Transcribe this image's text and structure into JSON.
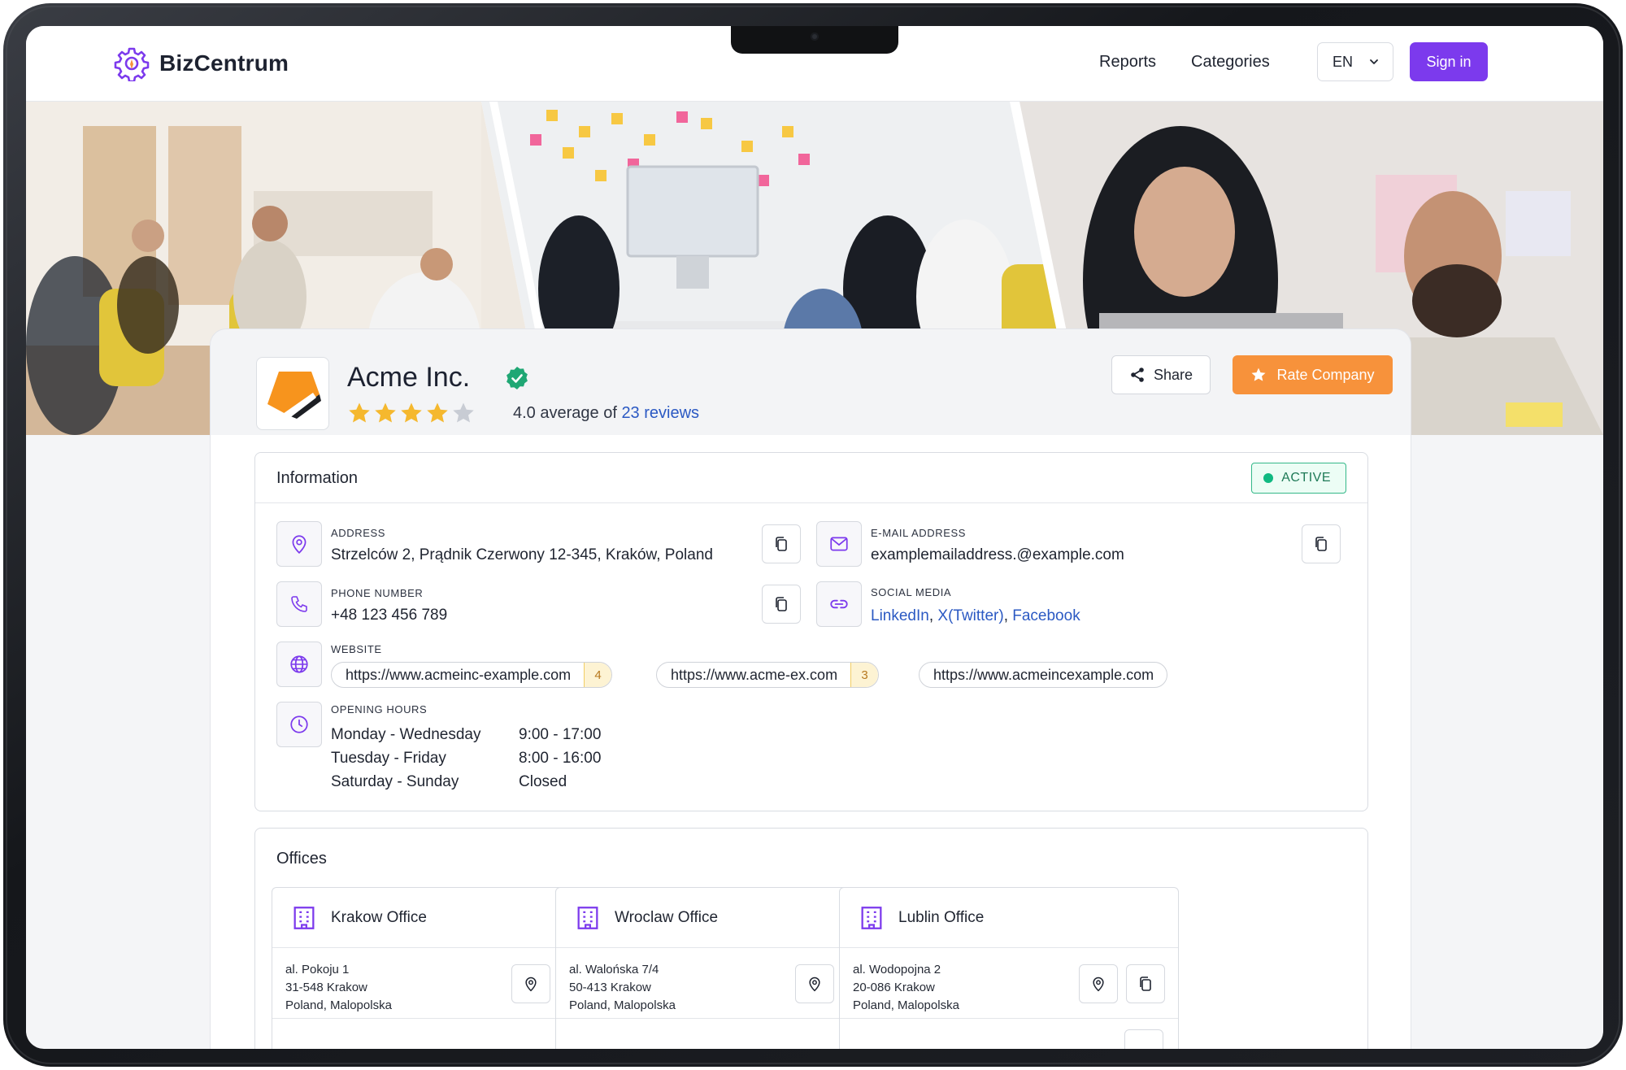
{
  "app": {
    "brand": "BizCentrum"
  },
  "nav": {
    "reports": "Reports",
    "categories": "Categories",
    "language": "EN",
    "sign_in": "Sign in"
  },
  "company": {
    "name": "Acme Inc.",
    "verified": true,
    "rating": 4.0,
    "rating_max": 5,
    "rating_prefix": "4.0 average of",
    "reviews_link": "23 reviews",
    "share_label": "Share",
    "rate_label": "Rate Company"
  },
  "information": {
    "title": "Information",
    "status": "ACTIVE",
    "address_label": "ADDRESS",
    "address": "Strzelców 2, Prądnik Czerwony 12-345, Kraków, Poland",
    "email_label": "E-MAIL ADDRESS",
    "email": "examplemailaddress.@example.com",
    "phone_label": "PHONE NUMBER",
    "phone": "+48 123 456 789",
    "social_label": "SOCIAL MEDIA",
    "social": [
      "LinkedIn",
      "X(Twitter)",
      "Facebook"
    ],
    "social_sep": ", ",
    "website_label": "WEBSITE",
    "websites": [
      {
        "url": "https://www.acmeinc-example.com",
        "count": "4"
      },
      {
        "url": "https://www.acme-ex.com",
        "count": "3"
      },
      {
        "url": "https://www.acmeincexample.com",
        "count": ""
      }
    ],
    "hours_label": "OPENING HOURS",
    "hours": [
      {
        "days": "Monday - Wednesday",
        "time": "9:00 - 17:00"
      },
      {
        "days": "Tuesday - Friday",
        "time": "8:00 - 16:00"
      },
      {
        "days": "Saturday - Sunday",
        "time": "Closed"
      }
    ]
  },
  "offices": {
    "title": "Offices",
    "items": [
      {
        "name": "Krakow Office",
        "line1": "al. Pokoju 1",
        "line2": "31-548 Krakow",
        "line3": "Poland, Malopolska"
      },
      {
        "name": "Wroclaw Office",
        "line1": "al. Walońska 7/4",
        "line2": "50-413 Krakow",
        "line3": "Poland, Malopolska"
      },
      {
        "name": "Lublin Office",
        "line1": "al. Wodopojna 2",
        "line2": "20-086 Krakow",
        "line3": "Poland, Malopolska"
      }
    ]
  },
  "colors": {
    "accent": "#7c3aed",
    "rate": "#f7923b",
    "link": "#2b59c3",
    "active": "#10b981",
    "star": "#f5b82e"
  },
  "icons": [
    "gear-logo-icon",
    "verified-icon",
    "star-icon",
    "share-icon",
    "map-pin-icon",
    "mail-icon",
    "phone-icon",
    "link-icon",
    "globe-icon",
    "clock-icon",
    "copy-icon",
    "building-icon",
    "chevron-down-icon"
  ]
}
